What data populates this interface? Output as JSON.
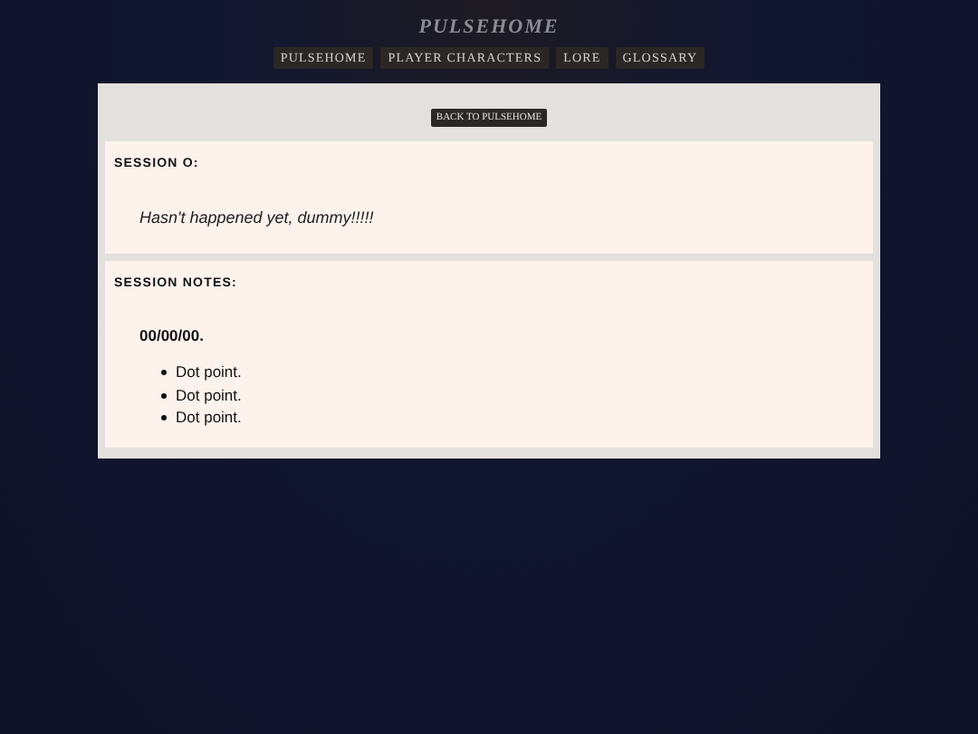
{
  "site_title": "PULSEHOME",
  "nav": [
    "PULSEHOME",
    "PLAYER CHARACTERS",
    "LORE",
    "GLOSSARY"
  ],
  "back_button": "BACK TO PULSEHOME",
  "sections": [
    {
      "heading": "SESSION O:",
      "kind": "note",
      "text": "Hasn't happened yet, dummy!!!!!"
    },
    {
      "heading": "SESSION NOTES:",
      "kind": "list",
      "date": "00/00/00.",
      "items": [
        "Dot point.",
        "Dot point.",
        "Dot point."
      ]
    }
  ]
}
